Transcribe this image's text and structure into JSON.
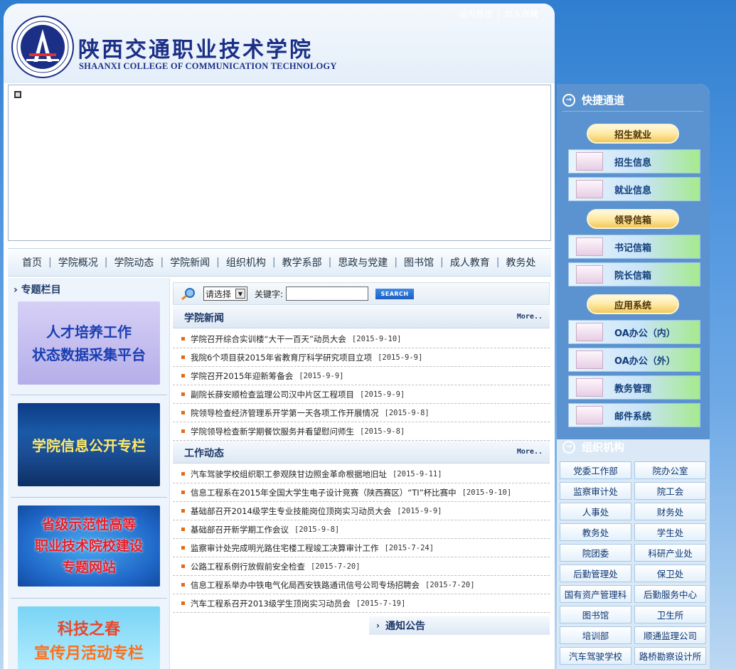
{
  "header": {
    "school_name_cn": "陕西交通职业技术学院",
    "school_name_en": "SHAANXI COLLEGE OF COMMUNICATION TECHNOLOGY",
    "set_homepage": "设为首页",
    "separator": "|",
    "add_favorite": "加入收藏"
  },
  "nav": {
    "items": [
      "首页",
      "学院概况",
      "学院动态",
      "学院新闻",
      "组织机构",
      "教学系部",
      "思政与党建",
      "图书馆",
      "成人教育",
      "教务处"
    ]
  },
  "special": {
    "title": "专题栏目",
    "talent": {
      "line1": "人才培养工作",
      "line2": "状态数据采集平台"
    },
    "info": "学院信息公开专栏",
    "model": {
      "line1": "省级示范性高等",
      "line2": "职业技术院校建设",
      "line3": "专题网站"
    },
    "tech": {
      "line1": "科技之春",
      "line2": "宣传月活动专栏"
    }
  },
  "search": {
    "select_value": "请选择",
    "keyword_label": "关键字:",
    "button_label": "SEARCH"
  },
  "college_news": {
    "title": "学院新闻",
    "more": "More..",
    "items": [
      {
        "text": "学院召开综合实训楼“大干一百天”动员大会",
        "date": "[2015-9-10]"
      },
      {
        "text": "我院6个项目获2015年省教育厅科学研究项目立项",
        "date": "[2015-9-9]"
      },
      {
        "text": "学院召开2015年迎新筹备会",
        "date": "[2015-9-9]"
      },
      {
        "text": "副院长薛安顺检查监理公司汉中片区工程项目",
        "date": "[2015-9-9]"
      },
      {
        "text": "院领导检查经济管理系开学第一天各项工作开展情况",
        "date": "[2015-9-8]"
      },
      {
        "text": "学院领导检查新学期餐饮服务并看望慰问师生",
        "date": "[2015-9-8]"
      }
    ]
  },
  "work_news": {
    "title": "工作动态",
    "more": "More..",
    "items": [
      {
        "text": "汽车驾驶学校组织职工参观陕甘边照金革命根据地旧址",
        "date": "[2015-9-11]"
      },
      {
        "text": "信息工程系在2015年全国大学生电子设计竞赛（陕西赛区）“TI”杯比赛中",
        "date": "[2015-9-10]"
      },
      {
        "text": "基础部召开2014级学生专业技能岗位顶岗实习动员大会",
        "date": "[2015-9-9]"
      },
      {
        "text": "基础部召开新学期工作会议",
        "date": "[2015-9-8]"
      },
      {
        "text": "监察审计处完成明光路住宅楼工程竣工决算审计工作",
        "date": "[2015-7-24]"
      },
      {
        "text": "公路工程系例行放假前安全检查",
        "date": "[2015-7-20]"
      },
      {
        "text": "信息工程系举办中铁电气化局西安铁路通讯信号公司专场招聘会",
        "date": "[2015-7-20]"
      },
      {
        "text": "汽车工程系召开2013级学生顶岗实习动员会",
        "date": "[2015-7-19]"
      }
    ]
  },
  "notice": {
    "title": "通知公告"
  },
  "quick": {
    "title": "快捷通道",
    "groups": [
      {
        "label": "招生就业",
        "buttons": [
          "招生信息",
          "就业信息"
        ]
      },
      {
        "label": "领导信箱",
        "buttons": [
          "书记信箱",
          "院长信箱"
        ]
      },
      {
        "label": "应用系统",
        "buttons": [
          "OA办公（内）",
          "OA办公（外）",
          "教务管理",
          "邮件系统"
        ]
      }
    ]
  },
  "org": {
    "title": "组织机构",
    "items": [
      "党委工作部",
      "院办公室",
      "监察审计处",
      "院工会",
      "人事处",
      "财务处",
      "教务处",
      "学生处",
      "院团委",
      "科研产业处",
      "后勤管理处",
      "保卫处",
      "国有资产管理科",
      "后勤服务中心",
      "图书馆",
      "卫生所",
      "培训部",
      "顺通监理公司",
      "汽车驾驶学校",
      "路桥勘察设计所"
    ]
  },
  "colors": {
    "brand": "#1b2f86",
    "accent_orange": "#e46a17",
    "sidebar_blue": "#5a93cf"
  }
}
